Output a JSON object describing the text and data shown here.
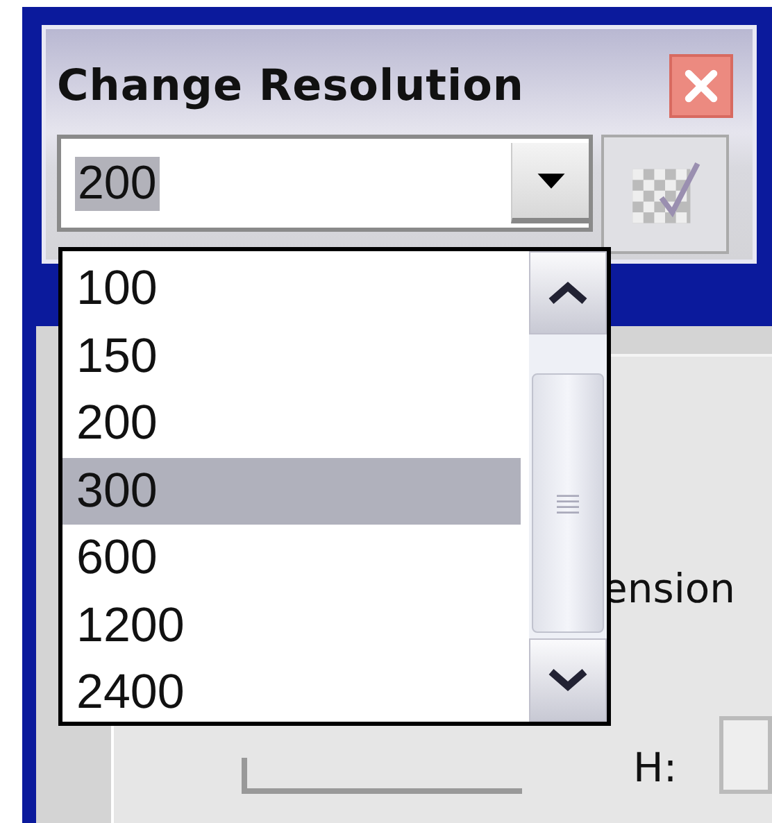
{
  "window": {
    "title": "Change Resolution"
  },
  "resolution_combo": {
    "value": "200",
    "text_selected": true
  },
  "dropdown": {
    "open": true,
    "items": [
      {
        "label": "100",
        "selected": false
      },
      {
        "label": "150",
        "selected": false
      },
      {
        "label": "200",
        "selected": false
      },
      {
        "label": "300",
        "selected": true
      },
      {
        "label": "600",
        "selected": false
      },
      {
        "label": "1200",
        "selected": false
      },
      {
        "label": "2400",
        "selected": false
      }
    ]
  },
  "dialog": {
    "label": "ension",
    "field_label": "H:"
  }
}
